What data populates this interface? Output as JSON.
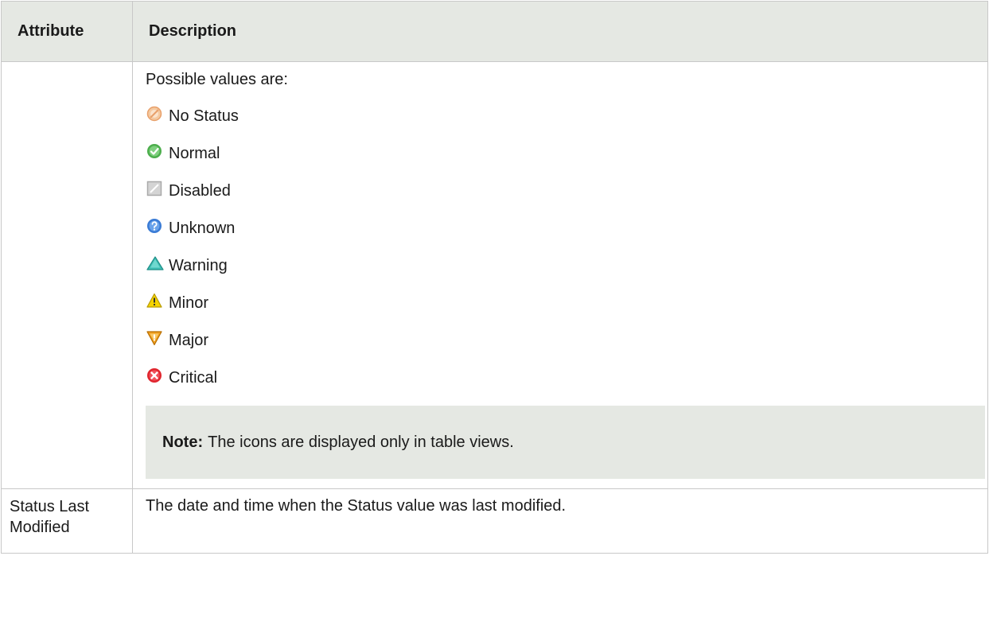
{
  "table": {
    "headers": {
      "attribute": "Attribute",
      "description": "Description"
    },
    "status_row": {
      "intro": "Possible values are:",
      "statuses": [
        {
          "label": "No Status",
          "icon": "no-status-icon"
        },
        {
          "label": "Normal",
          "icon": "normal-icon"
        },
        {
          "label": "Disabled",
          "icon": "disabled-icon"
        },
        {
          "label": "Unknown",
          "icon": "unknown-icon"
        },
        {
          "label": "Warning",
          "icon": "warning-icon"
        },
        {
          "label": "Minor",
          "icon": "minor-icon"
        },
        {
          "label": "Major",
          "icon": "major-icon"
        },
        {
          "label": "Critical",
          "icon": "critical-icon"
        }
      ],
      "note_label": "Note:",
      "note_text": "The icons are displayed only in table views."
    },
    "modified_row": {
      "attribute_line1": "Status Last",
      "attribute_line2": "Modified",
      "description": "The date and time when the Status value was last modified."
    }
  },
  "colors": {
    "header_bg": "#e5e8e3",
    "note_bg": "#e5e8e3",
    "border": "#c8c8c8",
    "no_status": "#f0b080",
    "normal": "#5cb85c",
    "disabled": "#c8c8c8",
    "unknown": "#3a7bd5",
    "warning": "#2fa8a0",
    "minor": "#f2d000",
    "major": "#f0a020",
    "critical": "#e0262e"
  }
}
